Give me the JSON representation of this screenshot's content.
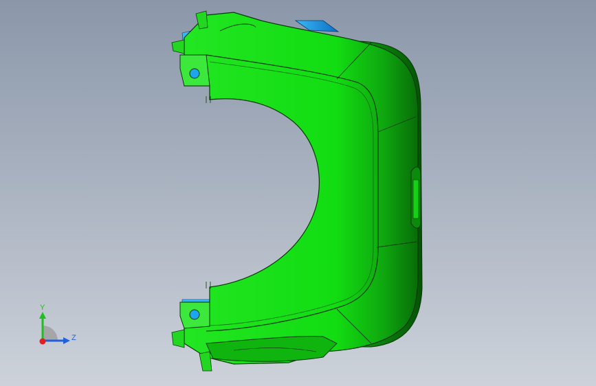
{
  "viewport": {
    "background_top": "#8b97a9",
    "background_bottom": "#cdd2da"
  },
  "model": {
    "primary_color": "#12e012",
    "secondary_color": "#1ea5f0",
    "edge_color": "#0a3a0a"
  },
  "triad": {
    "y_label": "Y",
    "z_label": "Z",
    "y_color": "#1fbf1f",
    "z_color": "#1f5fe0",
    "x_color": "#e02020"
  }
}
